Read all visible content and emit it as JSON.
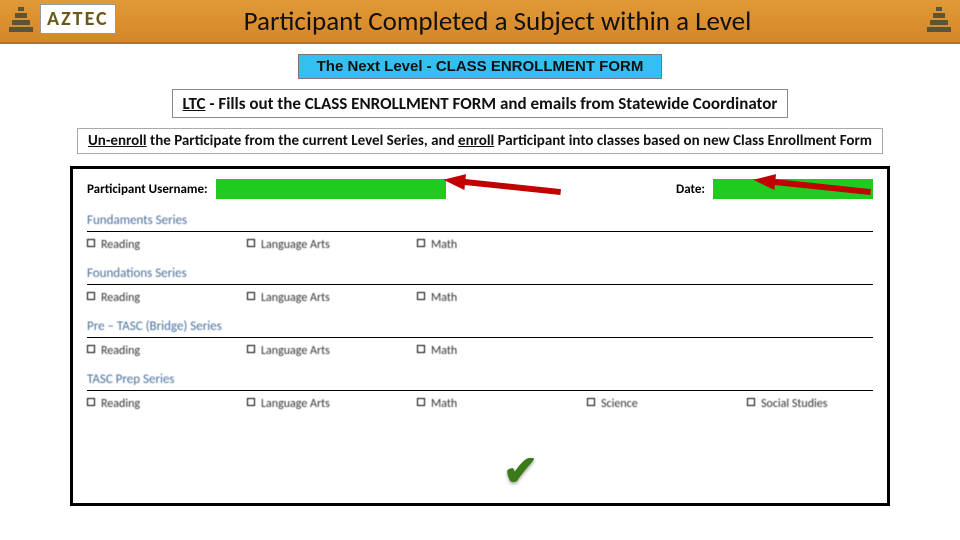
{
  "brand": "AZTEC",
  "title": "Participant Completed a Subject within a Level",
  "pill": "The Next Level - CLASS ENROLLMENT FORM",
  "subline_prefix": "LTC",
  "subline_rest": " - Fills out the CLASS ENROLLMENT FORM and emails from Statewide Coordinator",
  "instr_p1": "Un-enroll",
  "instr_p2": " the Participate from the current Level Series, and ",
  "instr_p3": "enroll",
  "instr_p4": " Participant into classes based on new Class Enrollment Form",
  "form": {
    "username_label": "Participant Username:",
    "date_label": "Date:",
    "series": [
      {
        "title": "Fundaments Series",
        "opts": [
          "Reading",
          "Language Arts",
          "Math"
        ]
      },
      {
        "title": "Foundations Series",
        "opts": [
          "Reading",
          "Language Arts",
          "Math"
        ]
      },
      {
        "title": "Pre – TASC (Bridge) Series",
        "opts": [
          "Reading",
          "Language Arts",
          "Math"
        ]
      },
      {
        "title": "TASC Prep Series",
        "opts": [
          "Reading",
          "Language Arts",
          "Math",
          "Science",
          "Social Studies"
        ]
      }
    ]
  },
  "check_mark": "✔"
}
